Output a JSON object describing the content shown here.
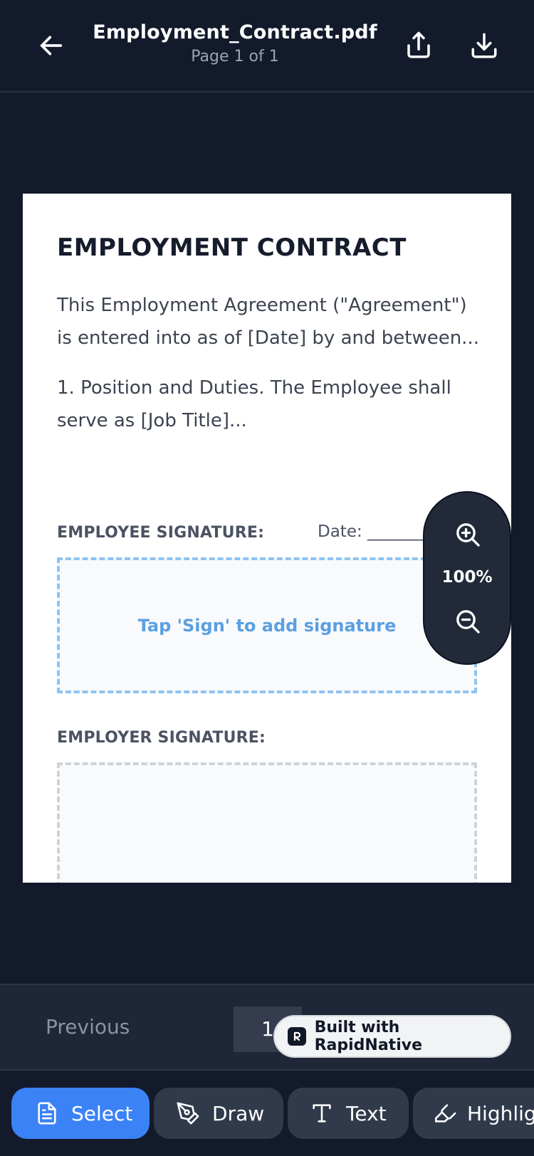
{
  "header": {
    "file_title": "Employment_Contract.pdf",
    "page_indicator": "Page 1 of 1",
    "icons": {
      "back": "arrow-left-icon",
      "share": "share-icon",
      "download": "download-icon"
    }
  },
  "document": {
    "heading": "EMPLOYMENT CONTRACT",
    "paragraph_1": "This Employment Agreement (\"Agreement\") is entered into as of [Date] by and between...",
    "paragraph_2": "1. Position and Duties. The Employee shall serve as [Job Title]...",
    "employee_signature_label": "EMPLOYEE SIGNATURE:",
    "date_label": "Date: _________",
    "employee_signature_hint": "Tap 'Sign' to add signature",
    "employer_signature_label": "EMPLOYER SIGNATURE:"
  },
  "zoom": {
    "level": "100%",
    "icons": {
      "zoom_in": "zoom-in-icon",
      "zoom_out": "zoom-out-icon"
    }
  },
  "pagination": {
    "previous_label": "Previous",
    "current_page": "1"
  },
  "badge": {
    "text": "Built with RapidNative"
  },
  "toolbar": {
    "tools": [
      {
        "label": "Select",
        "icon": "document-icon",
        "active": true
      },
      {
        "label": "Draw",
        "icon": "pen-icon",
        "active": false
      },
      {
        "label": "Text",
        "icon": "text-icon",
        "active": false
      },
      {
        "label": "Highlight",
        "icon": "highlighter-icon",
        "active": false
      }
    ]
  },
  "colors": {
    "background": "#131a2b",
    "accent": "#3b82f6",
    "signature_hint": "#5b9fe3"
  }
}
